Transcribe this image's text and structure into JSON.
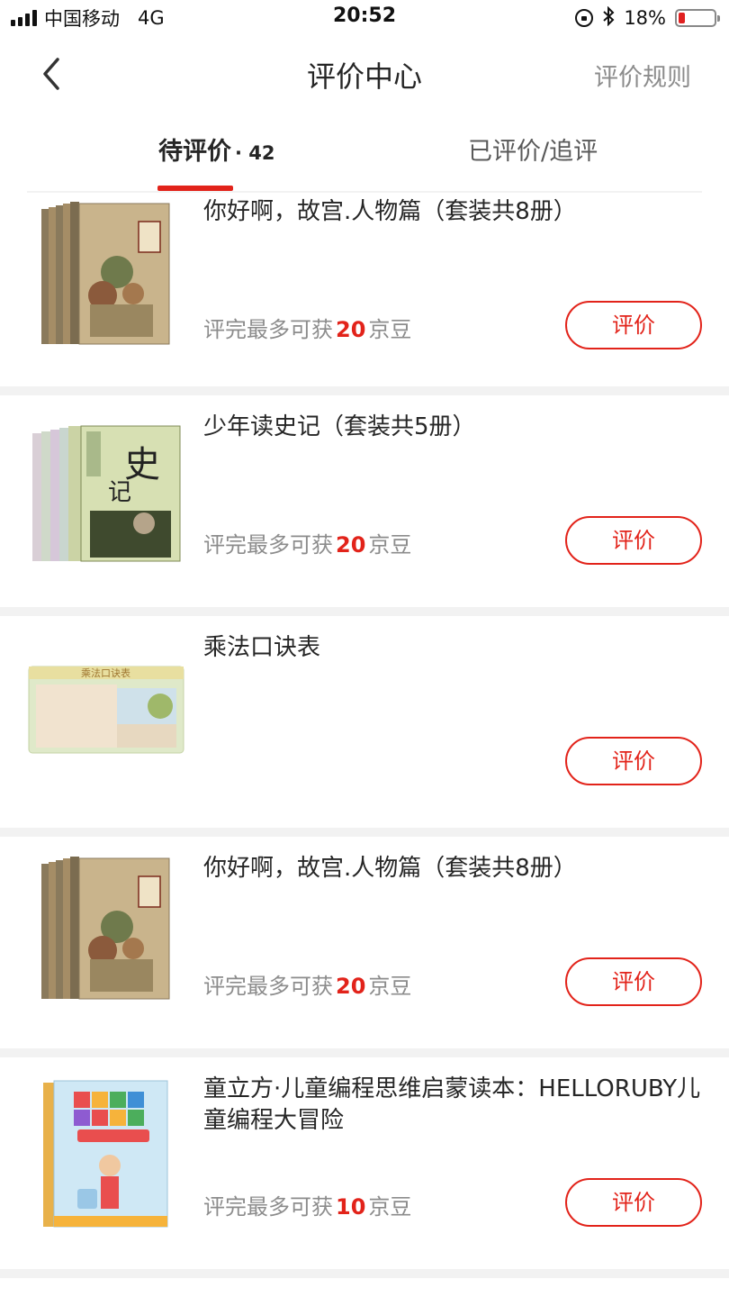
{
  "status_bar": {
    "carrier": "中国移动",
    "network": "4G",
    "time": "20:52",
    "battery": "18%",
    "battery_level": 0.18
  },
  "nav": {
    "title": "评价中心",
    "rules_link": "评价规则"
  },
  "tabs": {
    "pending_label": "待评价",
    "pending_count": "· 42",
    "done_label": "已评价/追评"
  },
  "items": [
    {
      "title": "你好啊，故宫.人物篇（套装共8册）",
      "reward_prefix": "评完最多可获",
      "reward_num": "20",
      "reward_unit": "京豆",
      "button": "评价",
      "thumb": "palace-book-set-icon"
    },
    {
      "title": "少年读史记（套装共5册）",
      "reward_prefix": "评完最多可获",
      "reward_num": "20",
      "reward_unit": "京豆",
      "button": "评价",
      "thumb": "history-book-set-icon"
    },
    {
      "title": "乘法口诀表",
      "reward_prefix": "",
      "reward_num": "",
      "reward_unit": "",
      "button": "评价",
      "thumb": "multiplication-chart-icon",
      "chart_label": "乘法口诀表"
    },
    {
      "title": "你好啊，故宫.人物篇（套装共8册）",
      "reward_prefix": "评完最多可获",
      "reward_num": "20",
      "reward_unit": "京豆",
      "button": "评价",
      "thumb": "palace-book-set-icon"
    },
    {
      "title": "童立方·儿童编程思维启蒙读本：HELLORUBY儿童编程大冒险",
      "reward_prefix": "评完最多可获",
      "reward_num": "10",
      "reward_unit": "京豆",
      "button": "评价",
      "thumb": "hello-ruby-book-icon"
    }
  ],
  "colors": {
    "accent": "#e2231a",
    "muted": "#8c8c8c",
    "text": "#262626",
    "divider": "#f2f2f2"
  }
}
